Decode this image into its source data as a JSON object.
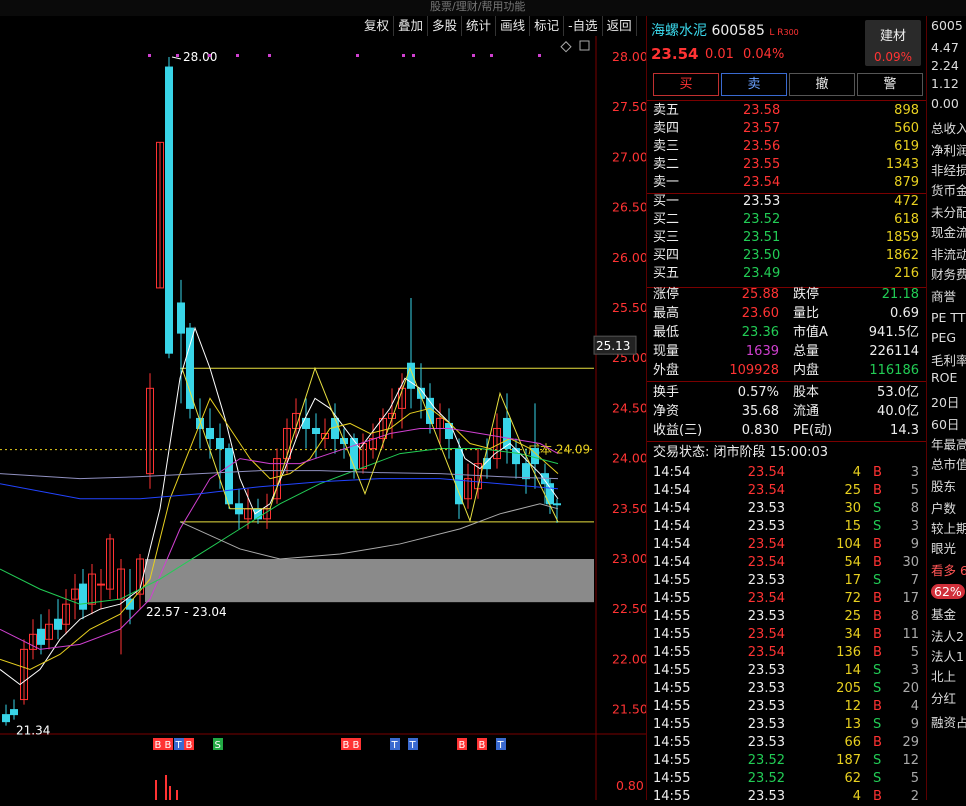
{
  "topbar": {
    "text": "股票/理财/帮用功能"
  },
  "toolbar": {
    "items": [
      "复权",
      "叠加",
      "多股",
      "统计",
      "画线",
      "标记",
      "-自选",
      "返回"
    ]
  },
  "chart": {
    "yaxis": [
      "28.00",
      "27.50",
      "27.00",
      "26.50",
      "26.00",
      "25.50",
      "25.00",
      "24.50",
      "24.00",
      "23.50",
      "23.00",
      "22.50",
      "22.00",
      "21.50"
    ],
    "price_marker": "25.13",
    "high_label": "28.00",
    "low_label": "21.34",
    "range_label": "22.57 - 23.04",
    "cost_label": "成本 24.09",
    "vol_tick": "0.80",
    "signals": [
      "B",
      "B",
      "T",
      "B",
      "S",
      "B",
      "B",
      "T",
      "T",
      "B",
      "B",
      "T"
    ]
  },
  "quote": {
    "name": "海螺水泥",
    "code": "600585",
    "flags": "L R",
    "flag_num": "300",
    "price": "23.54",
    "change": "0.01",
    "pct": "0.04%",
    "sector": "建材",
    "sector_pct": "0.09%",
    "buttons": [
      "买",
      "卖",
      "撤",
      "警"
    ]
  },
  "asks": [
    {
      "label": "卖五",
      "price": "23.58",
      "vol": "898"
    },
    {
      "label": "卖四",
      "price": "23.57",
      "vol": "560"
    },
    {
      "label": "卖三",
      "price": "23.56",
      "vol": "619"
    },
    {
      "label": "卖二",
      "price": "23.55",
      "vol": "1343"
    },
    {
      "label": "卖一",
      "price": "23.54",
      "vol": "879"
    }
  ],
  "bids": [
    {
      "label": "买一",
      "price": "23.53",
      "vol": "472"
    },
    {
      "label": "买二",
      "price": "23.52",
      "vol": "618"
    },
    {
      "label": "买三",
      "price": "23.51",
      "vol": "1859"
    },
    {
      "label": "买四",
      "price": "23.50",
      "vol": "1862"
    },
    {
      "label": "买五",
      "price": "23.49",
      "vol": "216"
    }
  ],
  "stats": [
    [
      "涨停",
      "25.88",
      "跌停",
      "21.18"
    ],
    [
      "最高",
      "23.60",
      "量比",
      "0.69"
    ],
    [
      "最低",
      "23.36",
      "市值A",
      "941.5亿"
    ],
    [
      "现量",
      "1639",
      "总量",
      "226114"
    ],
    [
      "外盘",
      "109928",
      "内盘",
      "116186"
    ]
  ],
  "stats2": [
    [
      "换手",
      "0.57%",
      "股本",
      "53.0亿"
    ],
    [
      "净资",
      "35.68",
      "流通",
      "40.0亿"
    ],
    [
      "收益(三)",
      "0.830",
      "PE(动)",
      "14.3"
    ]
  ],
  "trade_status": "交易状态: 闭市阶段 15:00:03",
  "ticks": [
    [
      "14:54",
      "23.54",
      "4",
      "B",
      "3"
    ],
    [
      "14:54",
      "23.54",
      "25",
      "B",
      "5"
    ],
    [
      "14:54",
      "23.53",
      "30",
      "S",
      "8"
    ],
    [
      "14:54",
      "23.53",
      "15",
      "S",
      "3"
    ],
    [
      "14:54",
      "23.54",
      "104",
      "B",
      "9"
    ],
    [
      "14:54",
      "23.54",
      "54",
      "B",
      "30"
    ],
    [
      "14:55",
      "23.53",
      "17",
      "S",
      "7"
    ],
    [
      "14:55",
      "23.54",
      "72",
      "B",
      "17"
    ],
    [
      "14:55",
      "23.53",
      "25",
      "B",
      "8"
    ],
    [
      "14:55",
      "23.54",
      "34",
      "B",
      "11"
    ],
    [
      "14:55",
      "23.54",
      "136",
      "B",
      "5"
    ],
    [
      "14:55",
      "23.53",
      "14",
      "S",
      "3"
    ],
    [
      "14:55",
      "23.53",
      "205",
      "S",
      "20"
    ],
    [
      "14:55",
      "23.53",
      "12",
      "B",
      "4"
    ],
    [
      "14:55",
      "23.53",
      "13",
      "S",
      "9"
    ],
    [
      "14:55",
      "23.53",
      "66",
      "B",
      "29"
    ],
    [
      "14:55",
      "23.52",
      "187",
      "S",
      "12"
    ],
    [
      "14:55",
      "23.52",
      "62",
      "S",
      "5"
    ],
    [
      "14:55",
      "23.53",
      "4",
      "B",
      "2"
    ]
  ],
  "farright": {
    "items": [
      "6005",
      "4.47",
      "2.24",
      "1.12",
      "0.00",
      "总收入",
      "净利润",
      "非经损",
      "货币金",
      "未分配",
      "现金流",
      "非流动",
      "财务费",
      "商誉",
      "PE TTM",
      "PEG",
      "毛利率",
      "ROE",
      "20日",
      "60日",
      "年最高",
      "总市值",
      "股东",
      "户数",
      "较上期",
      "眼光",
      "看多 6",
      "62%",
      "基金",
      "法人2",
      "法人1",
      "北上",
      "分红",
      "融资占"
    ]
  },
  "colors": {
    "up": "#ff3333",
    "down": "#39d5e8",
    "ma5": "#ffffff",
    "ma10": "#e8d020",
    "ma20": "#d040d0",
    "ma60": "#22cc55",
    "ma120": "#2244ff",
    "ma250": "#aaaaaa"
  }
}
